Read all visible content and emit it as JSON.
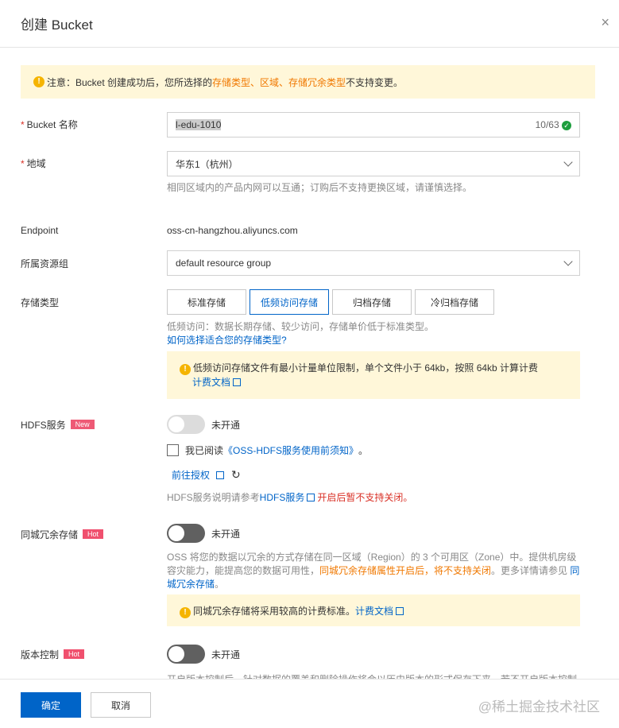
{
  "dialog": {
    "title": "创建 Bucket",
    "close": "×"
  },
  "notice": {
    "prefix": "注意：Bucket 创建成功后，您所选择的 ",
    "hl": "存储类型、区域、存储冗余类型",
    "suffix": " 不支持变更。"
  },
  "bucket_name": {
    "label": "Bucket 名称",
    "value": "l-edu-1010",
    "count": "10/63"
  },
  "region": {
    "label": "地域",
    "value": "华东1（杭州）",
    "hint": "相同区域内的产品内网可以互通；订购后不支持更换区域，请谨慎选择。"
  },
  "endpoint": {
    "label": "Endpoint",
    "value": "oss-cn-hangzhou.aliyuncs.com"
  },
  "resource_group": {
    "label": "所属资源组",
    "value": "default resource group"
  },
  "storage": {
    "label": "存储类型",
    "options": [
      "标准存储",
      "低频访问存储",
      "归档存储",
      "冷归档存储"
    ],
    "selected": "低频访问存储",
    "hint": "低频访问：数据长期存储、较少访问，存储单价低于标准类型。",
    "link": "如何选择适合您的存储类型?",
    "warn": "低频访问存储文件有最小计量单位限制，单个文件小于 64kb，按照 64kb 计算计费",
    "warn_link": "计费文档"
  },
  "hdfs": {
    "label": "HDFS服务",
    "tag": "New",
    "status": "未开通",
    "agree_prefix": "我已阅读",
    "agree_link": "《OSS-HDFS服务使用前须知》",
    "agree_suffix": "。",
    "auth_link": "前往授权",
    "hint_prefix": "HDFS服务说明请参考",
    "hint_link": "HDFS服务",
    "hint_red": "开启后暂不支持关闭。"
  },
  "zrs": {
    "label": "同城冗余存储",
    "tag": "Hot",
    "status": "未开通",
    "desc1": "OSS 将您的数据以冗余的方式存储在同一区域（Region）的 3 个可用区（Zone）中。提供机房级容灾能力，能提高您的数据可用性，",
    "desc_orange": "同城冗余存储属性开启后，将不支持关闭",
    "desc2": "。更多详情请参见 ",
    "desc_link": "同城冗余存储",
    "desc3": "。",
    "warn": "同城冗余存储将采用较高的计费标准。",
    "warn_link": "计费文档"
  },
  "versioning": {
    "label": "版本控制",
    "tag": "Hot",
    "status": "未开通",
    "desc": "开启版本控制后，针对数据的覆盖和删除操作将会以历史版本的形式保存下来。若不开启版本控制"
  },
  "footer": {
    "ok": "确定",
    "cancel": "取消",
    "watermark": "@稀土掘金技术社区"
  }
}
